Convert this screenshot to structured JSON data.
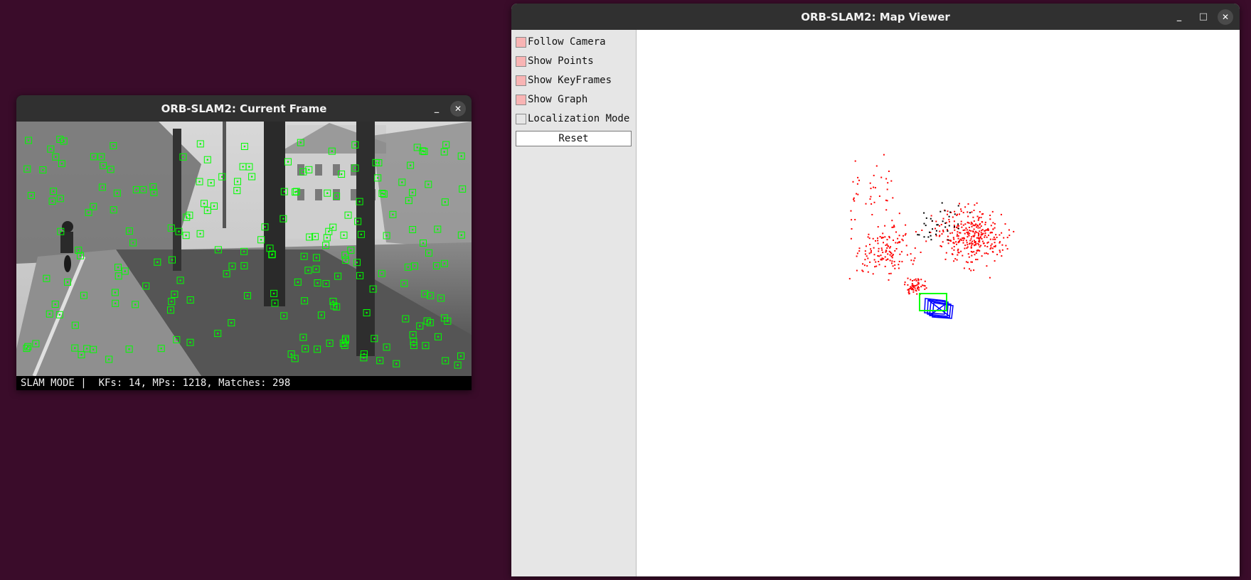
{
  "frame_window": {
    "title": "ORB-SLAM2: Current Frame",
    "minimize_symbol": "_",
    "close_symbol": "✕",
    "status": "SLAM MODE |  KFs: 14, MPs: 1218, Matches: 298"
  },
  "map_window": {
    "title": "ORB-SLAM2: Map Viewer",
    "minimize_symbol": "_",
    "maximize_symbol": "□",
    "close_symbol": "✕",
    "panel": {
      "options": [
        {
          "label": "Follow Camera",
          "checked": true
        },
        {
          "label": "Show Points",
          "checked": true
        },
        {
          "label": "Show KeyFrames",
          "checked": true
        },
        {
          "label": "Show Graph",
          "checked": true
        },
        {
          "label": "Localization Mode",
          "checked": false
        }
      ],
      "reset_label": "Reset"
    }
  },
  "colors": {
    "desktop": "#3a0c2a",
    "feature_box": "#00ff00",
    "map_point": "#ff0000",
    "local_map_point": "#000000",
    "keyframe": "#0000ff",
    "current_camera": "#00ff00"
  },
  "icons": [
    "minimize-icon",
    "maximize-icon",
    "close-icon",
    "checkbox-icon"
  ]
}
